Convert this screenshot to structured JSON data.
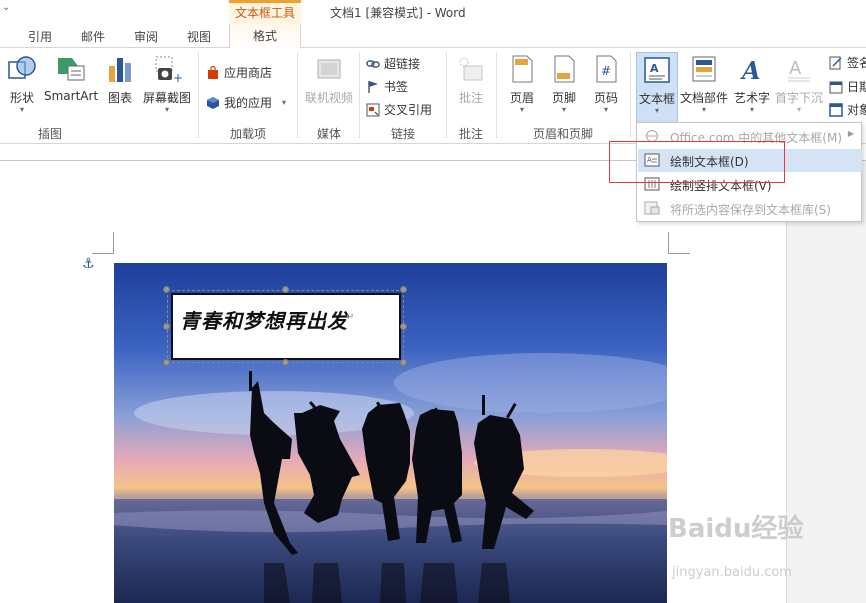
{
  "titlebar": {
    "context_tool": "文本框工具",
    "doc_title": "文档1 [兼容模式] - Word"
  },
  "tabs": {
    "items": [
      "引用",
      "邮件",
      "审阅",
      "视图"
    ],
    "context_tab": "格式"
  },
  "ribbon": {
    "illustrations": {
      "shapes": "形状",
      "smartart": "SmartArt",
      "chart": "图表",
      "screenshot": "屏幕截图",
      "label": "插图"
    },
    "addins": {
      "store": "应用商店",
      "my_apps": "我的应用",
      "label": "加载项"
    },
    "media": {
      "online_video": "联机视频",
      "label": "媒体"
    },
    "links": {
      "hyperlink": "超链接",
      "bookmark": "书签",
      "cross_ref": "交叉引用",
      "label": "链接"
    },
    "comments": {
      "comment": "批注",
      "label": "批注"
    },
    "header_footer": {
      "header": "页眉",
      "footer": "页脚",
      "page_number": "页码",
      "label": "页眉和页脚"
    },
    "text": {
      "textbox": "文本框",
      "quick_parts": "文档部件",
      "wordart": "艺术字",
      "drop_cap": "首字下沉",
      "signature": "签名",
      "date": "日期",
      "object": "对象"
    }
  },
  "menu": {
    "items": [
      {
        "label": "Office.com 中的其他文本框(M)",
        "disabled": true
      },
      {
        "label": "绘制文本框(D)",
        "disabled": false
      },
      {
        "label": "绘制竖排文本框(V)",
        "disabled": false
      },
      {
        "label": "将所选内容保存到文本框库(S)",
        "disabled": true
      }
    ]
  },
  "document": {
    "textbox_text": "青春和梦想再出发"
  },
  "colors": {
    "accent": "#2b579a",
    "context_orange": "#f0a030",
    "highlight_box": "#e23a3a",
    "menu_hover": "#d5e4f5"
  }
}
